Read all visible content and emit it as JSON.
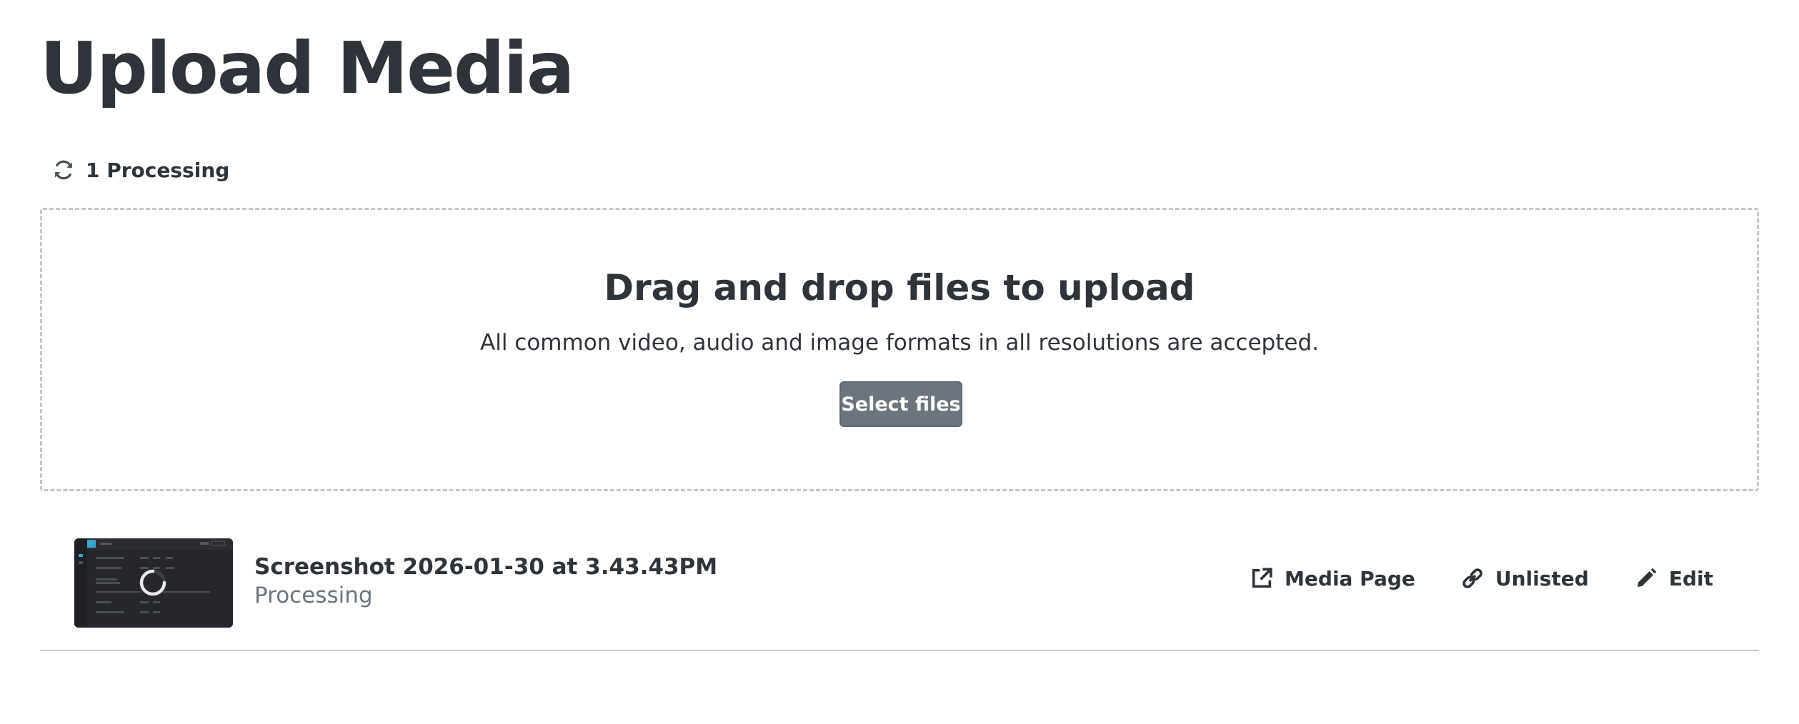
{
  "page": {
    "title": "Upload Media"
  },
  "processing": {
    "label": "1 Processing",
    "icon": "sync-icon"
  },
  "dropzone": {
    "title": "Drag and drop files to upload",
    "subtitle": "All common video, audio and image formats in all resolutions are accepted.",
    "button_label": "Select files"
  },
  "media_item": {
    "title": "Screenshot 2026-01-30 at 3.43.43PM",
    "status": "Processing",
    "actions": [
      {
        "label": "Media Page",
        "icon": "external-link-icon"
      },
      {
        "label": "Unlisted",
        "icon": "link-icon"
      },
      {
        "label": "Edit",
        "icon": "pencil-icon"
      }
    ]
  },
  "colors": {
    "text": "#2f343a",
    "muted": "#6c757d",
    "button_bg": "#6c757d",
    "border": "#c4c7ca",
    "thumbnail_bg": "#25272c"
  }
}
